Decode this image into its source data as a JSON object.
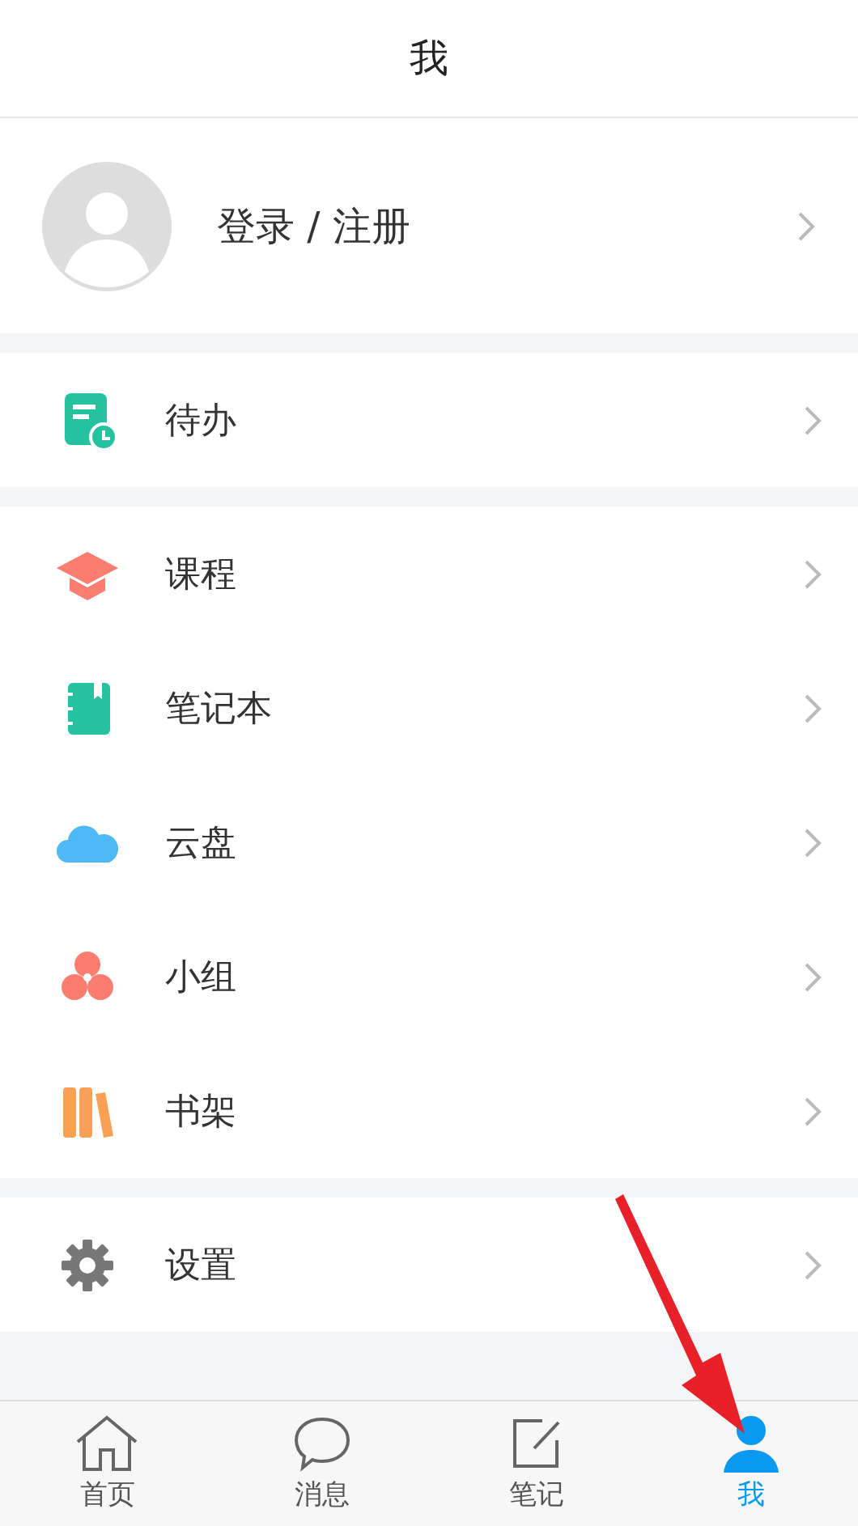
{
  "header": {
    "title": "我"
  },
  "profile": {
    "label": "登录 / 注册"
  },
  "sections": [
    {
      "items": [
        {
          "kind": "todo",
          "label": "待办"
        }
      ]
    },
    {
      "items": [
        {
          "kind": "course",
          "label": "课程"
        },
        {
          "kind": "notebook",
          "label": "笔记本"
        },
        {
          "kind": "cloud",
          "label": "云盘"
        },
        {
          "kind": "group",
          "label": "小组"
        },
        {
          "kind": "bookshelf",
          "label": "书架"
        }
      ]
    },
    {
      "items": [
        {
          "kind": "settings",
          "label": "设置"
        }
      ]
    }
  ],
  "tabs": [
    {
      "kind": "home",
      "label": "首页",
      "selected": false
    },
    {
      "kind": "message",
      "label": "消息",
      "selected": false
    },
    {
      "kind": "note",
      "label": "笔记",
      "selected": false
    },
    {
      "kind": "me",
      "label": "我",
      "selected": true
    }
  ]
}
